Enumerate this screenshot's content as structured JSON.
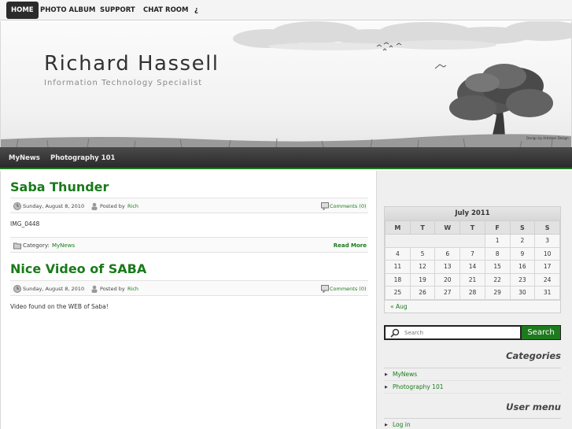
{
  "topnav": {
    "items": [
      {
        "label": "HOME",
        "active": true
      },
      {
        "label": "PHOTO ALBUM"
      },
      {
        "label": "SUPPORT"
      },
      {
        "label": "CHAT ROOM"
      },
      {
        "label": "¿"
      }
    ]
  },
  "header": {
    "title": "Richard Hassell",
    "subtitle": "Information Technology Specialist",
    "art_credit": "Design by Artisteer Design"
  },
  "subnav": {
    "items": [
      {
        "label": "MyNews"
      },
      {
        "label": "Photography 101"
      }
    ]
  },
  "posts": [
    {
      "title": "Saba Thunder",
      "date": "Sunday, August 8, 2010",
      "posted_by_label": "Posted by",
      "author": "Rich",
      "comments": "Comments (0)",
      "body": "IMG_0448",
      "category_label": "Category:",
      "category": "MyNews",
      "read_more": "Read More"
    },
    {
      "title": "Nice Video of SABA",
      "date": "Sunday, August 8, 2010",
      "posted_by_label": "Posted by",
      "author": "Rich",
      "comments": "Comments (0)",
      "body": "Video found on the WEB of Saba!"
    }
  ],
  "calendar": {
    "caption": "July 2011",
    "weekdays": [
      "M",
      "T",
      "W",
      "T",
      "F",
      "S",
      "S"
    ],
    "weeks": [
      [
        "",
        "",
        "",
        "",
        "1",
        "2",
        "3"
      ],
      [
        "4",
        "5",
        "6",
        "7",
        "8",
        "9",
        "10"
      ],
      [
        "11",
        "12",
        "13",
        "14",
        "15",
        "16",
        "17"
      ],
      [
        "18",
        "19",
        "20",
        "21",
        "22",
        "23",
        "24"
      ],
      [
        "25",
        "26",
        "27",
        "28",
        "29",
        "30",
        "31"
      ]
    ],
    "prev": "« Aug"
  },
  "search": {
    "placeholder": "Search",
    "button": "Search"
  },
  "categories": {
    "title": "Categories",
    "items": [
      "MyNews",
      "Photography 101"
    ]
  },
  "usermenu": {
    "title": "User menu",
    "items": [
      "Log in"
    ]
  },
  "colors": {
    "accent_green": "#1a7a1a",
    "nav_active": "#2b2b2b",
    "dark_bar": "#333333"
  }
}
